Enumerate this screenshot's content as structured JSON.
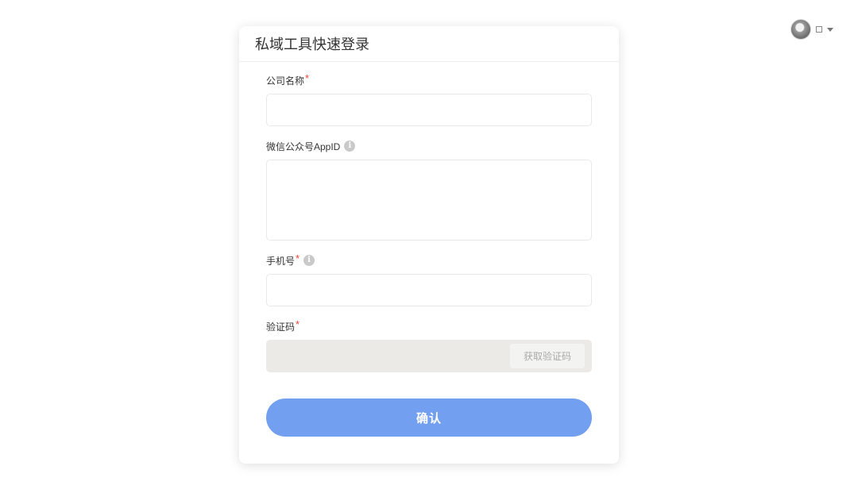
{
  "user_menu": {
    "avatar_icon": "user-avatar",
    "username": "□",
    "dropdown_icon": "caret-down-icon"
  },
  "card": {
    "title": "私域工具快速登录"
  },
  "form": {
    "company_name": {
      "label": "公司名称",
      "required": "*",
      "value": ""
    },
    "appid": {
      "label": "微信公众号AppID",
      "info_icon": "i",
      "value": ""
    },
    "phone": {
      "label": "手机号",
      "required": "*",
      "info_icon": "i",
      "value": ""
    },
    "code": {
      "label": "验证码",
      "required": "*",
      "value": "",
      "button_label": "获取验证码"
    }
  },
  "actions": {
    "confirm_label": "确认"
  },
  "colors": {
    "primary_button": "#739ff0",
    "required_star": "#f04134",
    "code_row_bg": "#ebeae6"
  }
}
